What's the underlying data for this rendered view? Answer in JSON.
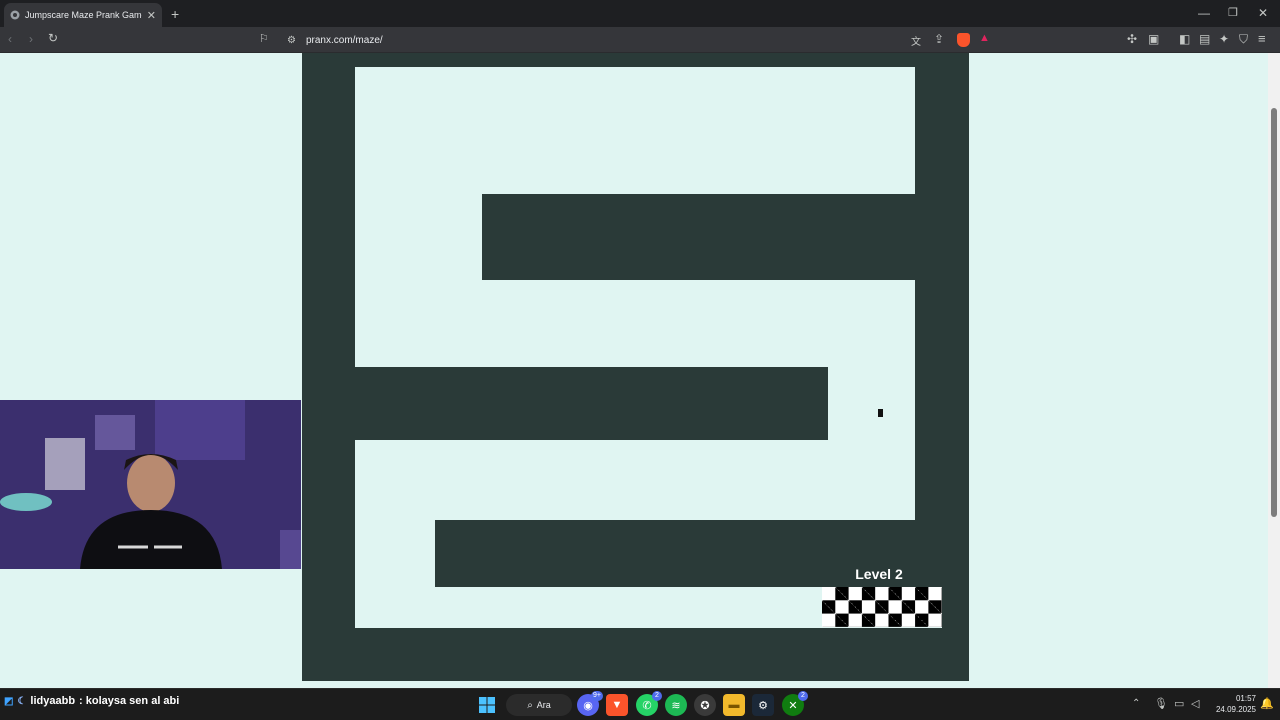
{
  "browser": {
    "tab_title": "Jumpscare Maze Prank Game O",
    "new_tab_icon": "plus-icon",
    "url": "pranx.com/maze/",
    "window_controls": [
      "minimize-icon",
      "restore-icon",
      "close-icon"
    ]
  },
  "game": {
    "level_label": "Level 2",
    "colors": {
      "wall": "#2a3a38",
      "path": "#e0f5f2",
      "finish_a": "#000000",
      "finish_b": "#ffffff"
    }
  },
  "overlay": {
    "chat_user": "lidyaabb",
    "chat_message": ": kolaysa sen al abi"
  },
  "taskbar": {
    "search_label": "Ara",
    "time": "01:57",
    "date": "24.09.2025",
    "badges": {
      "discord": "9+",
      "whatsapp": "2",
      "xbox": "2"
    }
  }
}
